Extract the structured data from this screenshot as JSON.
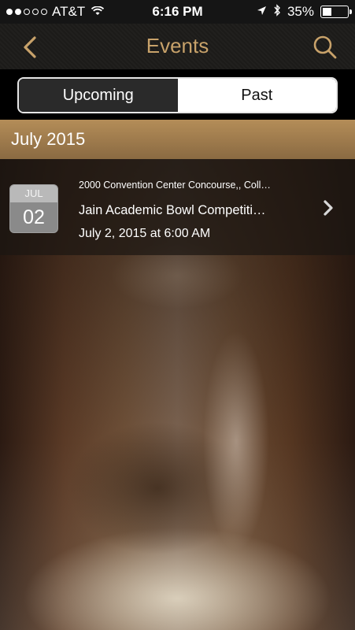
{
  "status_bar": {
    "signal_dots_filled": 2,
    "signal_dots_total": 5,
    "carrier": "AT&T",
    "time": "6:16 PM",
    "battery": "35%",
    "battery_level": 0.35
  },
  "nav": {
    "title": "Events",
    "back_icon": "chevron-left-icon",
    "search_icon": "search-icon",
    "accent_color": "#c8a26a"
  },
  "segments": {
    "upcoming_label": "Upcoming",
    "past_label": "Past",
    "selected": "Past"
  },
  "section": {
    "label": "July 2015"
  },
  "events": [
    {
      "month": "JUL",
      "day": "02",
      "location": "2000 Convention Center Concourse,, Coll…",
      "title": "Jain Academic Bowl Competiti…",
      "datetime": "July 2, 2015 at 6:00 AM"
    }
  ]
}
